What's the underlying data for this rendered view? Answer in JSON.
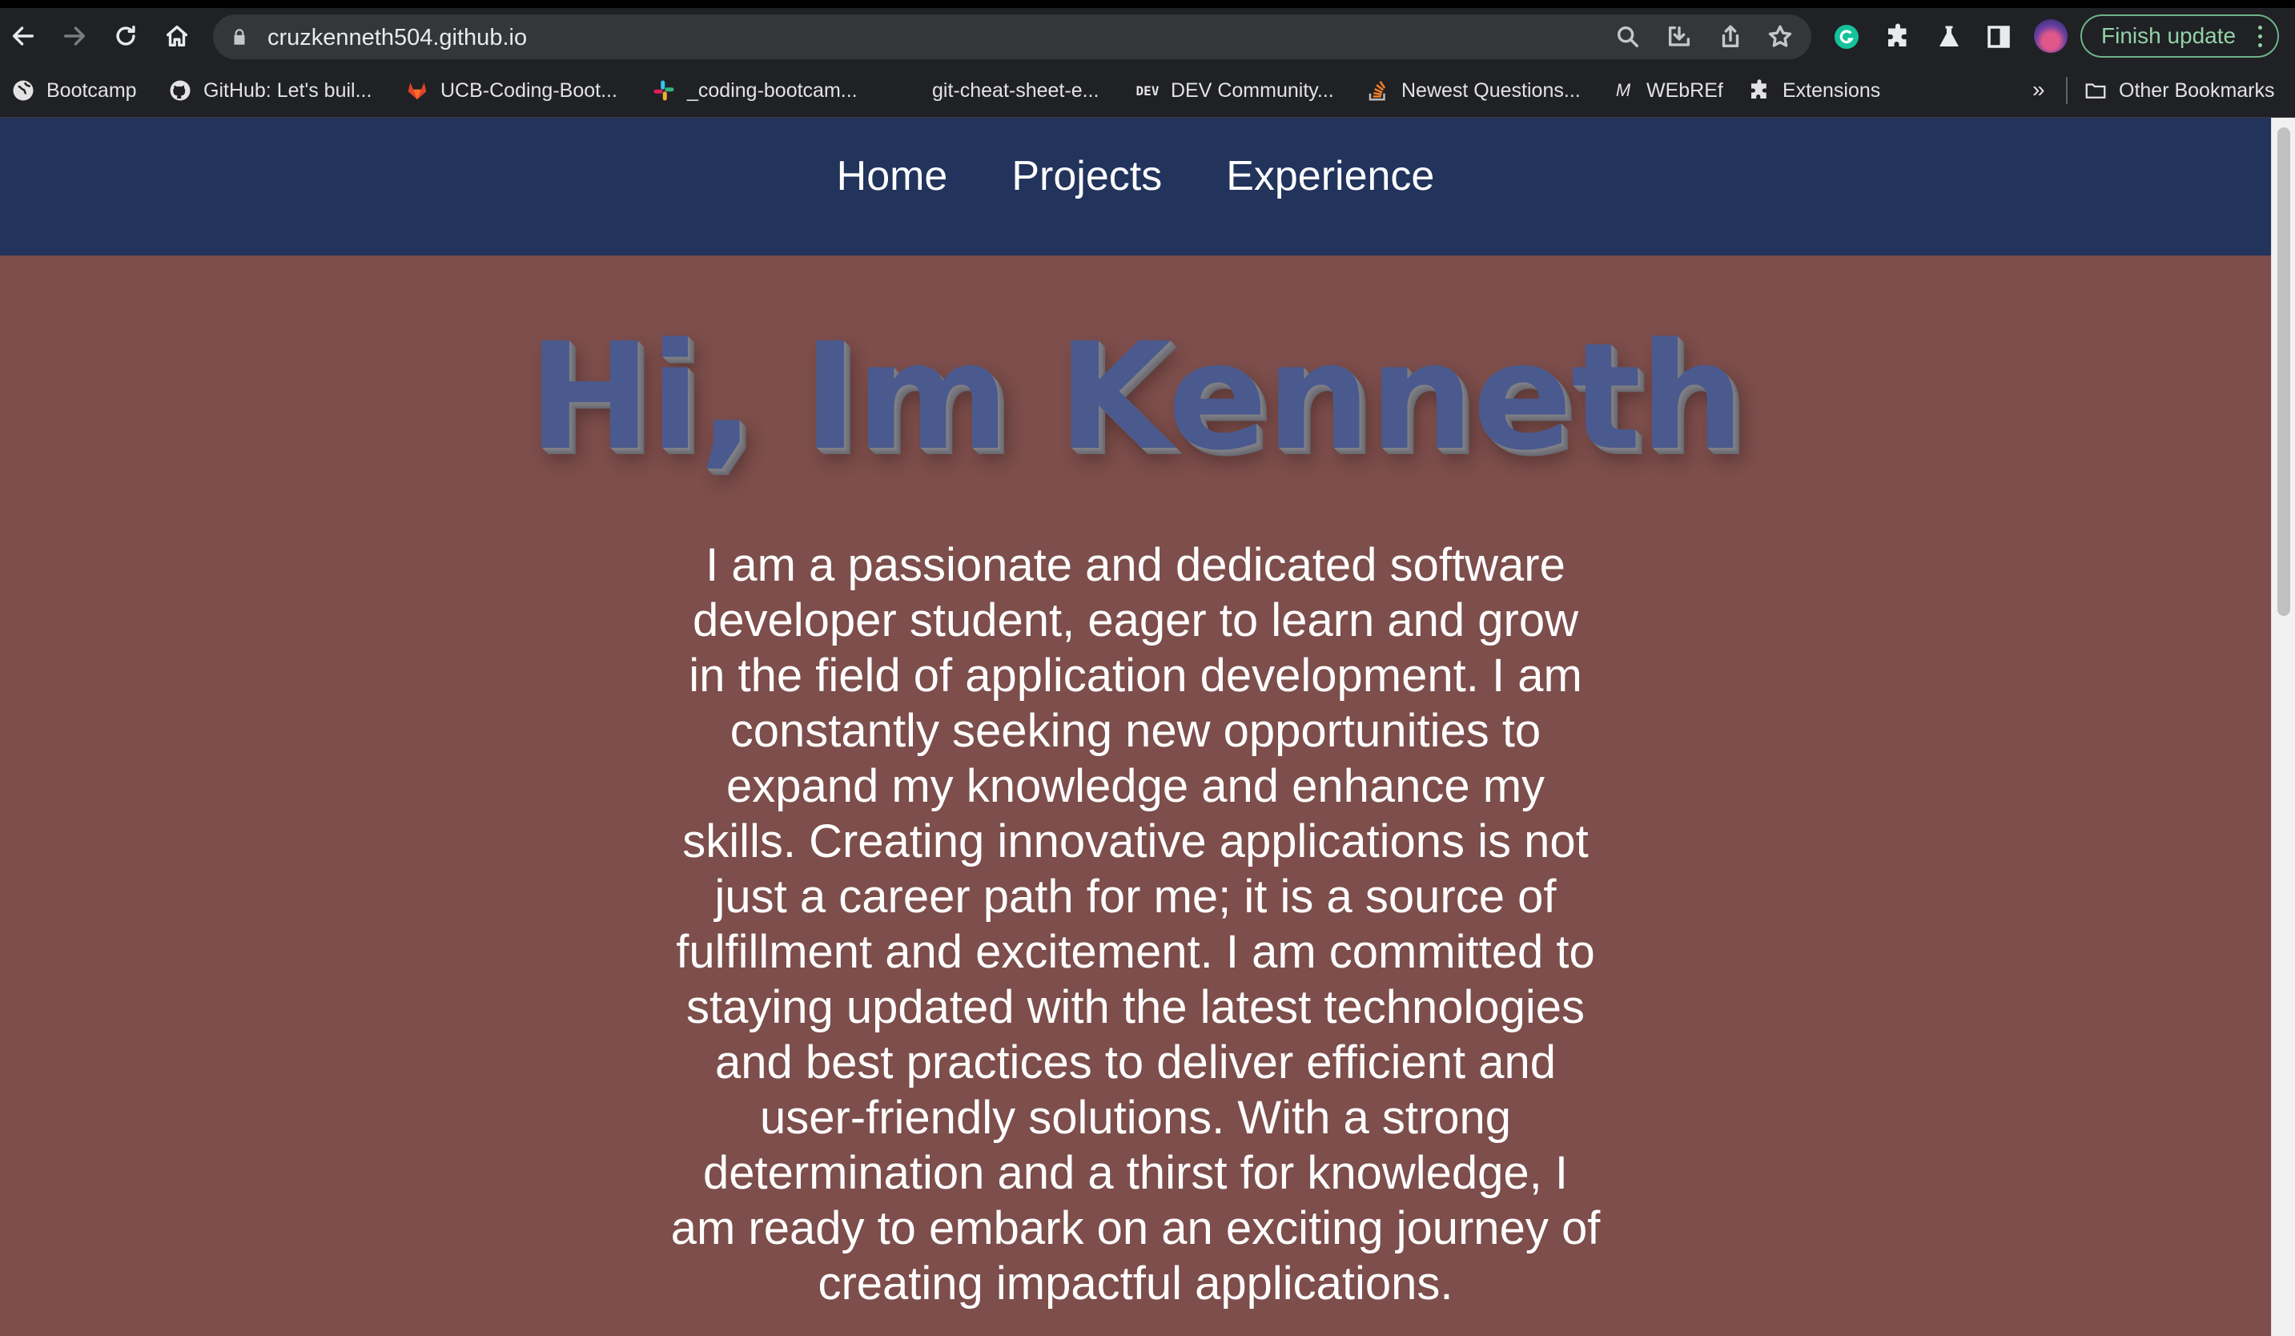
{
  "browser": {
    "url": "cruzkenneth504.github.io",
    "finish_update_label": "Finish update",
    "bookmarks": [
      {
        "label": "Bootcamp",
        "icon": "globe-icon"
      },
      {
        "label": "GitHub: Let's buil...",
        "icon": "github-icon"
      },
      {
        "label": "UCB-Coding-Boot...",
        "icon": "gitlab-icon"
      },
      {
        "label": "_coding-bootcam...",
        "icon": "slack-icon"
      },
      {
        "label": "git-cheat-sheet-e...",
        "icon": ""
      },
      {
        "label": "DEV Community...",
        "icon": "dev-icon"
      },
      {
        "label": "Newest Questions...",
        "icon": "stackoverflow-icon"
      },
      {
        "label": "WEbREf",
        "icon": "mdn-icon"
      },
      {
        "label": "Extensions",
        "icon": "puzzle-icon"
      }
    ],
    "overflow_label": "»",
    "other_bookmarks_label": "Other Bookmarks"
  },
  "nav": {
    "links": [
      "Home",
      "Projects",
      "Experience"
    ]
  },
  "hero": {
    "title": "Hi, Im Kenneth"
  },
  "bio": {
    "text": "I am a passionate and dedicated software developer student, eager to learn and grow in the field of application development. I am constantly seeking new opportunities to expand my knowledge and enhance my skills. Creating innovative applications is not just a career path for me; it is a source of fulfillment and excitement. I am committed to staying updated with the latest technologies and best practices to deliver efficient and user-friendly solutions. With a strong determination and a thirst for knowledge, I am ready to embark on an exciting journey of creating impactful applications."
  },
  "colors": {
    "navbar_bg": "#22335c",
    "page_bg": "#7d4e4b",
    "hero_text": "#4a5a8e",
    "update_button_accent": "#93d1a7"
  }
}
